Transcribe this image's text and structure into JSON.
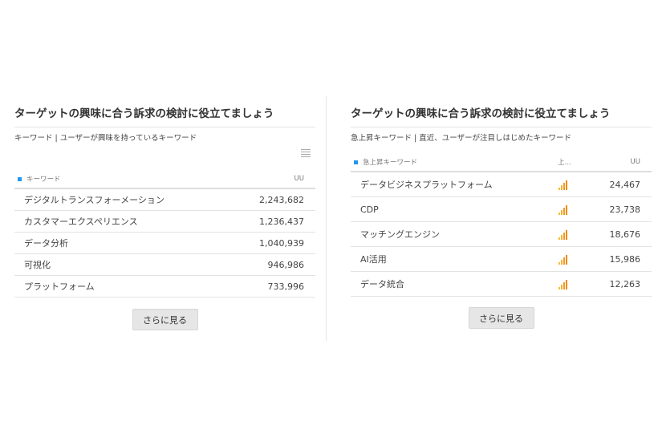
{
  "left": {
    "title": "ターゲットの興味に合う訴求の検討に役立てましょう",
    "subtitle": "キーワード | ユーザーが興味を持っているキーワード",
    "col_keyword": "キーワード",
    "col_uu": "UU",
    "rows": [
      {
        "keyword": "デジタルトランスフォーメーション",
        "uu": "2,243,682"
      },
      {
        "keyword": "カスタマーエクスペリエンス",
        "uu": "1,236,437"
      },
      {
        "keyword": "データ分析",
        "uu": "1,040,939"
      },
      {
        "keyword": "可視化",
        "uu": "946,986"
      },
      {
        "keyword": "プラットフォーム",
        "uu": "733,996"
      }
    ],
    "more_label": "さらに見る"
  },
  "right": {
    "title": "ターゲットの興味に合う訴求の検討に役立てましょう",
    "subtitle": "急上昇キーワード | 直近、ユーザーが注目しはじめたキーワード",
    "col_keyword": "急上昇キーワード",
    "col_trend": "上...",
    "col_uu": "UU",
    "rows": [
      {
        "keyword": "データビジネスプラットフォーム",
        "uu": "24,467"
      },
      {
        "keyword": "CDP",
        "uu": "23,738"
      },
      {
        "keyword": "マッチングエンジン",
        "uu": "18,676"
      },
      {
        "keyword": "AI活用",
        "uu": "15,986"
      },
      {
        "keyword": "データ統合",
        "uu": "12,263"
      }
    ],
    "more_label": "さらに見る"
  },
  "colors": {
    "accent": "#2196f3",
    "trend_bars": "#f39c1f",
    "button_bg": "#e6e6e6"
  }
}
